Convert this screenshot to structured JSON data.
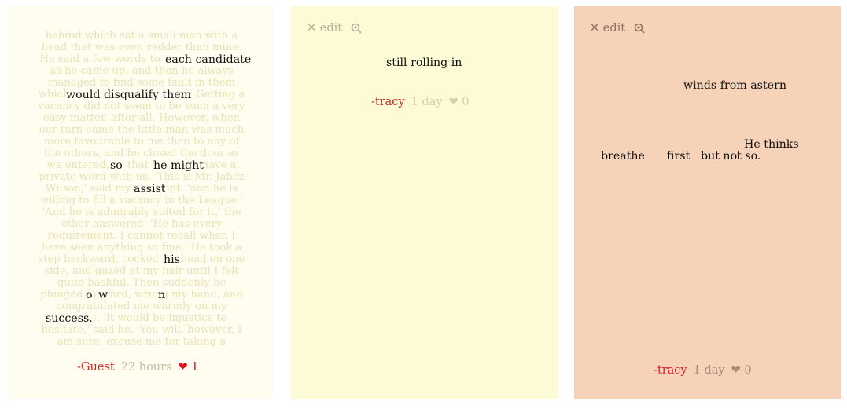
{
  "cards": [
    {
      "background_text": "behind which sat a small man with a\nhead that was even redder than mine.\nHe said a few words to each candidate\nas he came up, and then he always\nmanaged to find some fault in them\nwhich would disqualify them. Getting a\nvacancy did not seem to be such a very\neasy matter, after all. However, when\nour turn came the little man was much\nmore favourable to me than to any of\nthe others, and he closed the door as\nwe entered, so that he might have a\nprivate word with us. 'This is Mr. Jabez\nWilson,' said my assistant, 'and he is\nwilling to fill a vacancy in the League.'\n'And he is admirably suited for it,' the\nother answered. 'He has every\nrequirement. I cannot recall when I\nhave seen anything so fine.' He took a\nstep backward, cocked his head on one\nside, and gazed at my hair until I felt\nquite bashful. Then suddenly he\nplunged forward, wrung my hand, and\ncongratulated me warmly on my\nsuccess. 'It would be injustice to\nhesitate,' said he. 'You will, however, I\nam sure, excuse me for taking a",
      "highlights": [
        "each candidate",
        "would disqualify them",
        "so",
        "he might",
        "assist",
        "his",
        "o",
        "w",
        "n",
        "success."
      ],
      "author": "-Guest",
      "time": "22 hours",
      "likes": "❤ 1"
    },
    {
      "toolbar": {
        "edit": "✕ edit"
      },
      "words": [
        "still rolling in"
      ],
      "author": "-tracy",
      "time": "1 day",
      "likes": "❤ 0"
    },
    {
      "toolbar": {
        "edit": "✕ edit"
      },
      "words": [
        "winds from astern",
        "He thinks",
        "breathe",
        "first",
        "but not so."
      ],
      "author": "-tracy",
      "time": "1 day",
      "likes": "❤ 0"
    }
  ]
}
